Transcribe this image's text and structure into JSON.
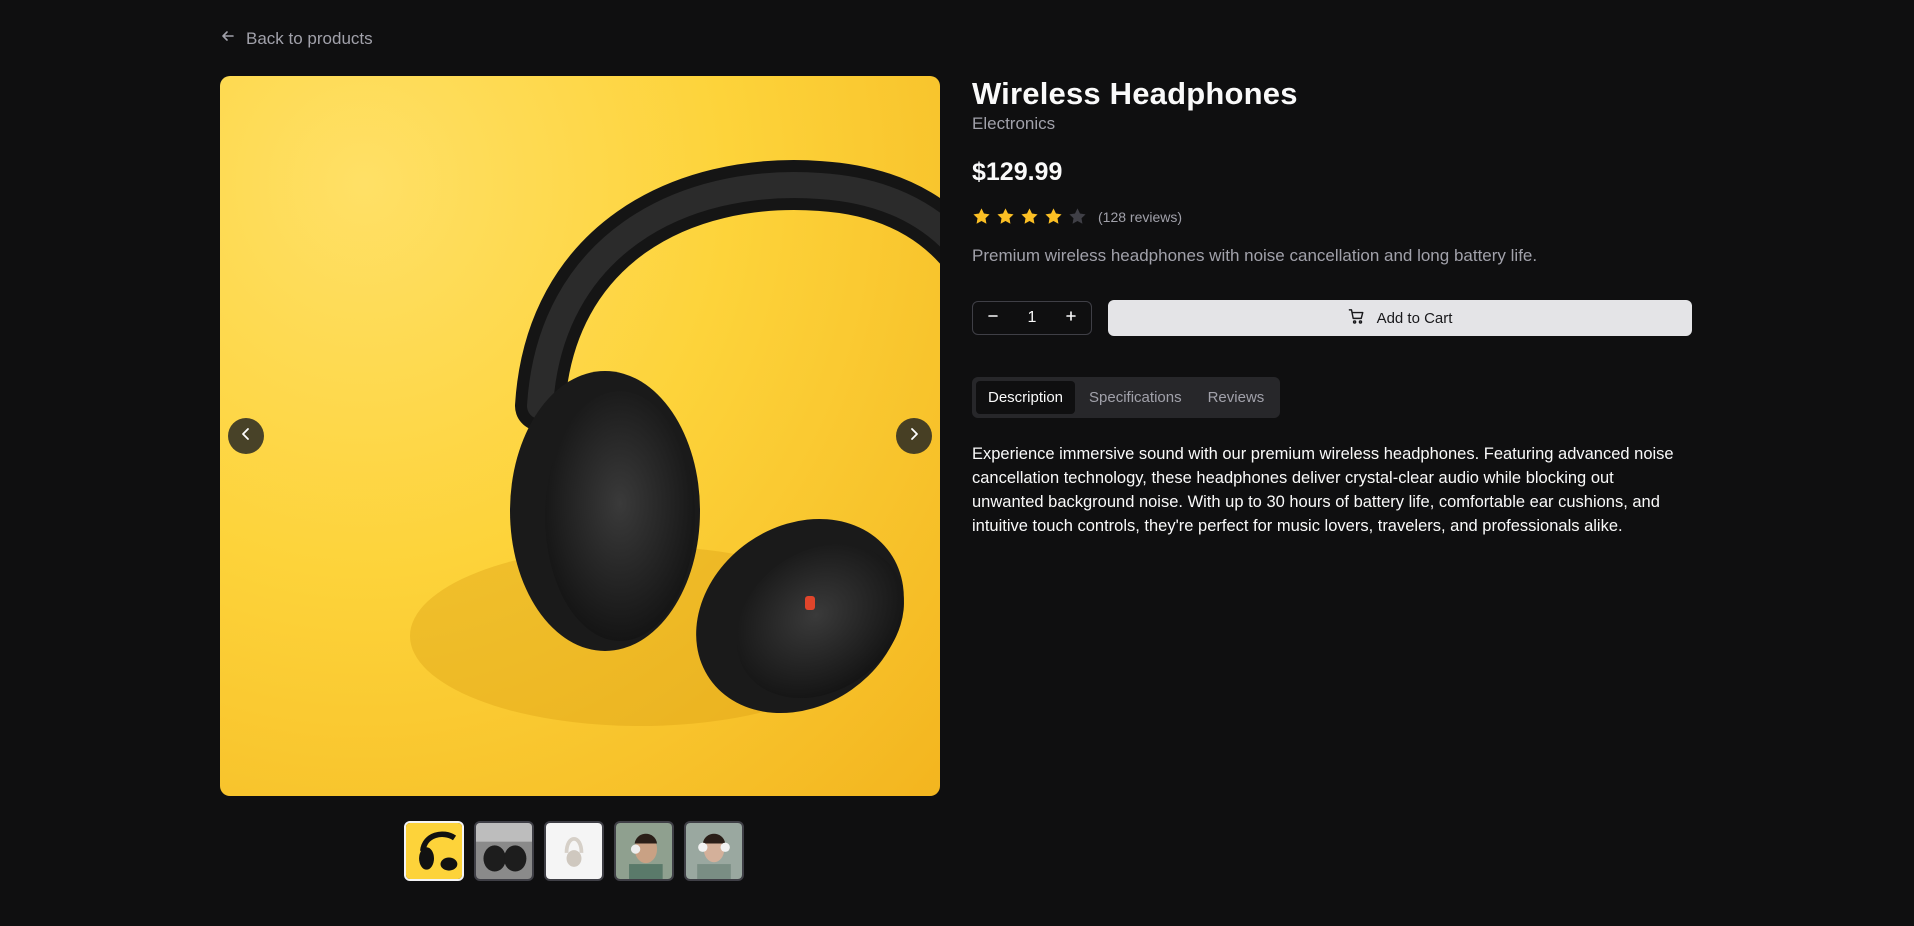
{
  "nav": {
    "back_label": "Back to products"
  },
  "product": {
    "title": "Wireless Headphones",
    "category": "Electronics",
    "price": "$129.99",
    "rating": 4,
    "rating_max": 5,
    "reviews_label": "(128 reviews)",
    "short_description": "Premium wireless headphones with noise cancellation and long battery life."
  },
  "cart": {
    "quantity": "1",
    "add_label": "Add to Cart"
  },
  "tabs": [
    {
      "label": "Description",
      "active": true
    },
    {
      "label": "Specifications",
      "active": false
    },
    {
      "label": "Reviews",
      "active": false
    }
  ],
  "description": "Experience immersive sound with our premium wireless headphones. Featuring advanced noise cancellation technology, these headphones deliver crystal-clear audio while blocking out unwanted background noise. With up to 30 hours of battery life, comfortable ear cushions, and intuitive touch controls, they're perfect for music lovers, travelers, and professionals alike.",
  "gallery": {
    "selected_index": 0,
    "thumbnail_count": 5
  },
  "colors": {
    "background": "#0f0f10",
    "star_filled": "#fbbf24",
    "star_empty": "#3f3f46",
    "cart_button": "#e4e4e7",
    "image_background": "#fdd33a"
  }
}
